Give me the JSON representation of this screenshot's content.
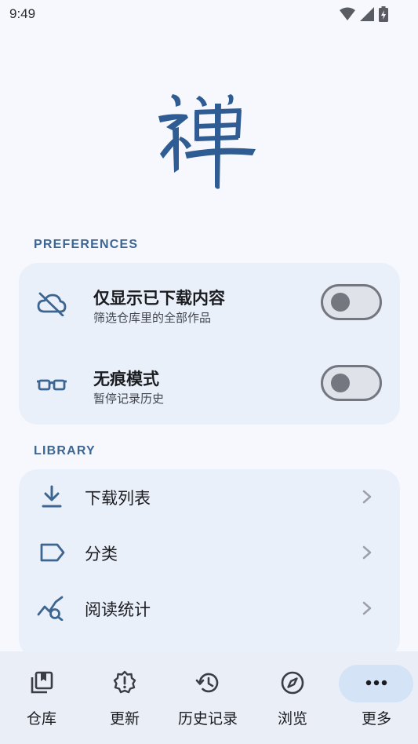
{
  "status_bar": {
    "time": "9:49"
  },
  "logo": {
    "glyph": "禅"
  },
  "preferences": {
    "title": "PREFERENCES",
    "items": [
      {
        "icon": "cloud-off-icon",
        "title": "仅显示已下载内容",
        "subtitle": "筛选仓库里的全部作品",
        "toggle_on": false
      },
      {
        "icon": "glasses-icon",
        "title": "无痕模式",
        "subtitle": "暂停记录历史",
        "toggle_on": false
      }
    ]
  },
  "library": {
    "title": "LIBRARY",
    "items": [
      {
        "icon": "download-icon",
        "label": "下载列表"
      },
      {
        "icon": "label-tag-icon",
        "label": "分类"
      },
      {
        "icon": "query-stats-icon",
        "label": "阅读统计"
      }
    ]
  },
  "bottom_nav": {
    "items": [
      {
        "icon": "library-icon",
        "label": "仓库"
      },
      {
        "icon": "new-releases-icon",
        "label": "更新"
      },
      {
        "icon": "history-icon",
        "label": "历史记录"
      },
      {
        "icon": "explore-icon",
        "label": "浏览"
      },
      {
        "icon": "more-horiz-icon",
        "label": "更多",
        "selected": true
      }
    ]
  },
  "colors": {
    "accent": "#3d6592",
    "logo": "#2f5c93",
    "card": "#eaf0f9",
    "nav_pill": "#d5e3f7"
  }
}
